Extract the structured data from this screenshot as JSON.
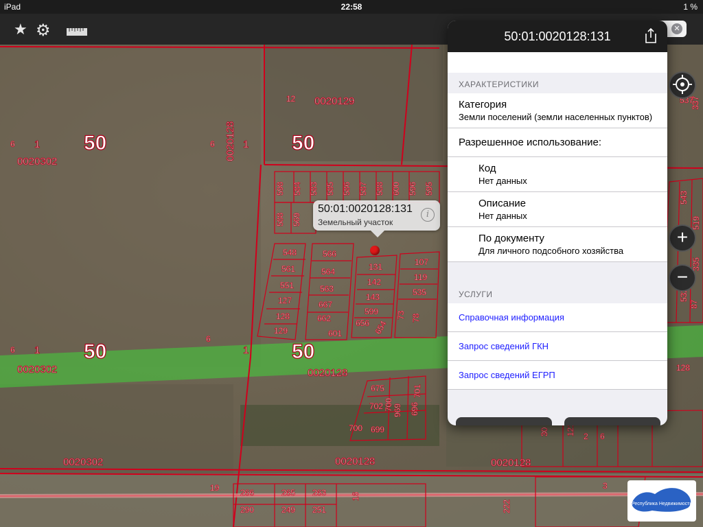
{
  "status_bar": {
    "device": "iPad",
    "time": "22:58",
    "battery": "1 %"
  },
  "toolbar": {
    "favorites_icon": "star-icon",
    "settings_icon": "gears-icon",
    "ruler_icon": "ruler-icon"
  },
  "map": {
    "quarters": [
      "0020302",
      "0020129",
      "0020128",
      "0020302",
      "0020128",
      "0020302",
      "0020128",
      "0020128"
    ],
    "big_labels": [
      "50",
      "50",
      "50",
      "50"
    ],
    "small_labels": [
      "6",
      "1",
      "6",
      "1",
      "12",
      "6",
      "1",
      "6",
      "1",
      "19"
    ],
    "plots": [
      "598",
      "584",
      "583",
      "585",
      "586",
      "587",
      "588",
      "600",
      "596",
      "595",
      "588",
      "569",
      "548",
      "566",
      "561",
      "564",
      "551",
      "563",
      "127",
      "667",
      "128",
      "662",
      "129",
      "601",
      "131",
      "142",
      "143",
      "599",
      "656",
      "654",
      "73",
      "107",
      "119",
      "535",
      "78",
      "675",
      "702",
      "700",
      "699",
      "700",
      "969",
      "696",
      "701",
      "266",
      "265",
      "263",
      "290",
      "249",
      "251",
      "16",
      "30",
      "121",
      "2",
      "3",
      "6",
      "222",
      "543",
      "519",
      "537",
      "335",
      "532",
      "87",
      "128",
      "337"
    ],
    "callout": {
      "title": "50:01:0020128:131",
      "subtitle": "Земельный участок"
    },
    "logo_text": "Республика Недвижимость"
  },
  "popover": {
    "title": "50:01:0020128:131",
    "section_characteristics": "ХАРАКТЕРИСТИКИ",
    "category_label": "Категория",
    "category_value": "Земли поселений (земли населенных пунктов)",
    "permitted_use_label": "Разрешенное использование:",
    "code_label": "Код",
    "code_value": "Нет данных",
    "description_label": "Описание",
    "description_value": "Нет данных",
    "by_document_label": "По документу",
    "by_document_value": "Для личного подсобного хозяйства",
    "section_services": "УСЛУГИ",
    "services": [
      "Справочная информация",
      "Запрос сведений ГКН",
      "Запрос сведений ЕГРП"
    ]
  },
  "colors": {
    "boundary": "#d0001c",
    "zone": "#3fcf3a",
    "link": "#2020ff",
    "toolbar": "#262626"
  }
}
